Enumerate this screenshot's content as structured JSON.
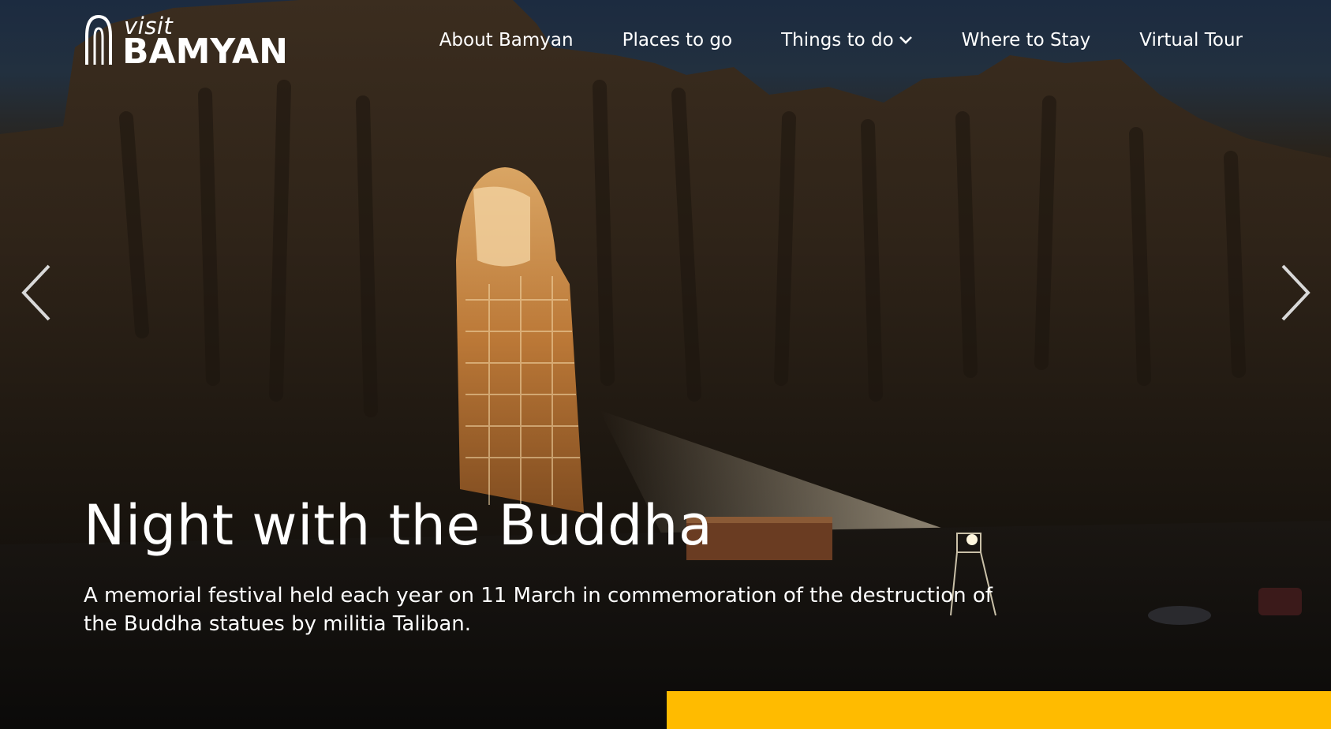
{
  "logo": {
    "visit": "visit",
    "name": "BAMYAN"
  },
  "nav": {
    "items": [
      {
        "label": "About Bamyan"
      },
      {
        "label": "Places to go"
      },
      {
        "label": "Things to do",
        "icon": "chevron-down-icon"
      },
      {
        "label": "Where to Stay"
      },
      {
        "label": "Virtual Tour"
      }
    ]
  },
  "slider": {
    "prev_icon": "chevron-left-icon",
    "next_icon": "chevron-right-icon"
  },
  "hero": {
    "title": "Night with the Buddha",
    "description": "A memorial festival held each year on 11 March in commemoration of the destruction of the Buddha statues by militia Taliban."
  },
  "colors": {
    "accent": "#ffbb00",
    "text": "#ffffff",
    "sky": "#1f2f44"
  }
}
